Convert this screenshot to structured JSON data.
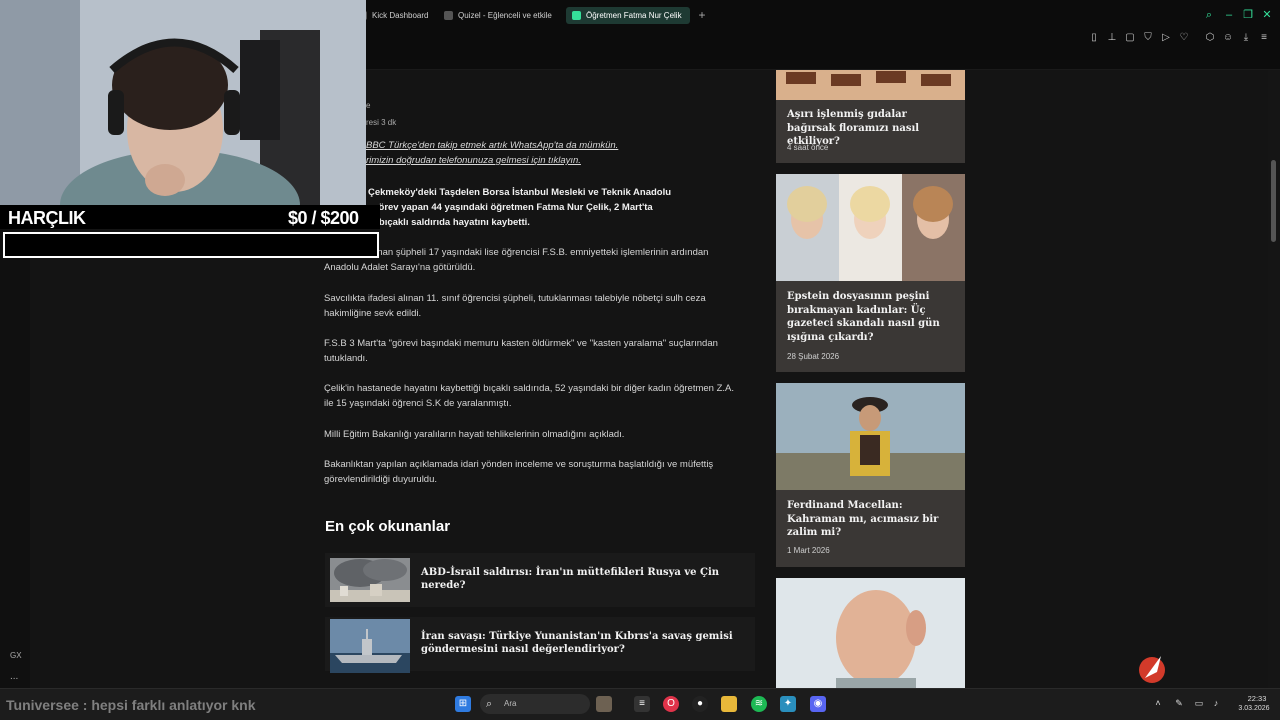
{
  "browser": {
    "tabs": [
      {
        "label": "Kick Dashboard",
        "active": false
      },
      {
        "label": "Quizel - Eğlenceli ve etkile",
        "active": false
      },
      {
        "label": "Öğretmen Fatma Nur Çelik",
        "active": true
      }
    ],
    "new_tab": "+",
    "window_controls": [
      "search-icon",
      "minimize-icon",
      "restore-icon",
      "close-icon"
    ],
    "toolbar_icons": [
      "sidebar-icon",
      "pin-icon",
      "snapshot-icon",
      "shield-icon",
      "play-icon",
      "heart-icon",
      "extensions-icon",
      "account-icon",
      "download-icon",
      "menu-icon"
    ],
    "accent_color": "#35e09a"
  },
  "article": {
    "byline_fragment": "e",
    "read_time": "resi 3 dk",
    "whatsapp_line1": "BBC Türkçe'den takip etmek artık WhatsApp'ta da mümkün.",
    "whatsapp_line2": "rimizin doğrudan telefonunuza gelmesi için tıklayın.",
    "lead_line1": "Çekmeköy'deki Taşdelen Borsa İstanbul Mesleki ve Teknik Anadolu",
    "lead_line2": "Lisesi'nde görev yapan 44 yaşındaki öğretmen Fatma Nur Çelik, 2 Mart'ta",
    "lead_line3": "düzenlenen bıçaklı saldırıda hayatını kaybetti.",
    "p1": "Gözaltına alınan şüpheli 17 yaşındaki lise öğrencisi F.S.B. emniyetteki işlemlerinin ardından Anadolu Adalet Sarayı'na götürüldü.",
    "p2": "Savcılıkta ifadesi alınan 11. sınıf öğrencisi şüpheli, tutuklanması talebiyle nöbetçi sulh ceza hakimliğine sevk edildi.",
    "p3": "F.S.B 3 Mart'ta \"görevi başındaki memuru kasten öldürmek\" ve \"kasten yaralama\" suçlarından tutuklandı.",
    "p4": "Çelik'in hastanede hayatını kaybettiği bıçaklı saldırıda, 52 yaşındaki bir diğer kadın öğretmen Z.A. ile 15 yaşındaki öğrenci S.K de yaralanmıştı.",
    "p5": "Milli Eğitim Bakanlığı yaralıların hayati tehlikelerinin olmadığını açıkladı.",
    "p6": "Bakanlıktan yapılan açıklamada idari yönden inceleme ve soruşturma başlatıldığı ve müfettiş görevlendirildiği duyuruldu."
  },
  "most_read": {
    "title": "En çok okunanlar",
    "items": [
      {
        "title": "ABD-İsrail saldırısı: İran'ın müttefikleri Rusya ve Çin nerede?"
      },
      {
        "title": "İran savaşı: Türkiye Yunanistan'ın Kıbrıs'a savaş gemisi göndermesini nasıl değerlendiriyor?"
      }
    ]
  },
  "sidebar_cards": [
    {
      "title": "Aşırı işlenmiş gıdalar bağırsak floramızı nasıl etkiliyor?",
      "time": "4 saat önce"
    },
    {
      "title": "Epstein dosyasının peşini bırakmayan kadınlar: Üç gazeteci skandalı nasıl gün ışığına çıkardı?",
      "time": "28 Şubat 2026"
    },
    {
      "title": "Ferdinand Macellan: Kahraman mı, acımasız bir zalim mi?",
      "time": "1 Mart 2026"
    }
  ],
  "stream_overlay": {
    "budget_label": "HARÇLIK",
    "budget_amount": "$0 / $200",
    "budget_progress": 0,
    "ticker": "Tuniversee : hepsi farklı anlatıyor knk",
    "gx_label": "GX",
    "gx_dots": "..."
  },
  "taskbar": {
    "search_placeholder": "Ara",
    "time": "22:33",
    "date": "3.03.2026",
    "apps": [
      "windows-start-icon",
      "search-icon",
      "elephant-icon",
      "files-icon",
      "opera-icon",
      "obs-icon",
      "folder-icon",
      "spotify-icon",
      "vpn-icon",
      "discord-icon"
    ],
    "tray": [
      "chevron-up-icon",
      "pen-icon",
      "mic-icon",
      "display-icon",
      "wifi-icon",
      "volume-icon"
    ]
  }
}
